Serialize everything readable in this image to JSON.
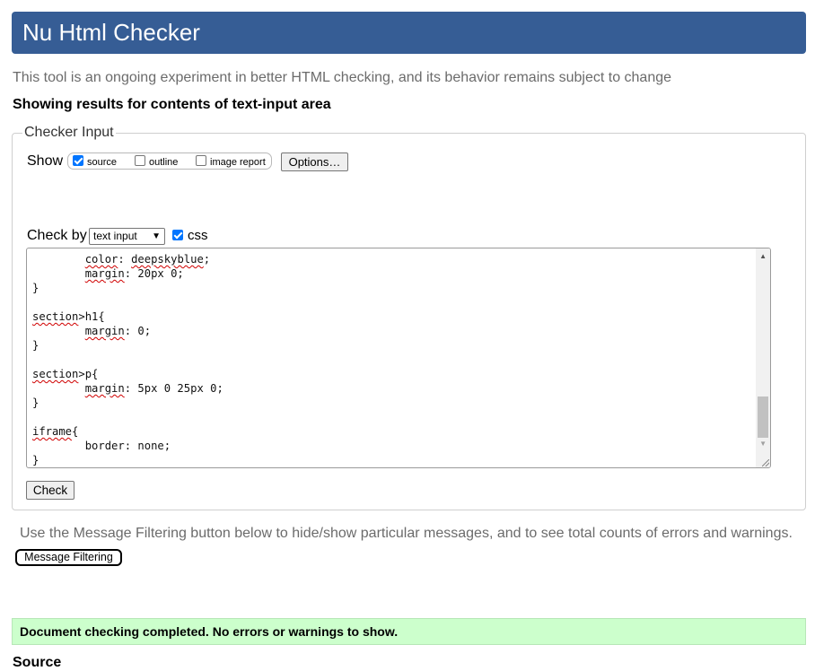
{
  "header": {
    "title": "Nu Html Checker"
  },
  "intro_text": "This tool is an ongoing experiment in better HTML checking, and its behavior remains subject to change",
  "results_heading": "Showing results for contents of text-input area",
  "checker_input": {
    "legend": "Checker Input",
    "show_label": "Show",
    "show_options": [
      {
        "label": "source",
        "checked": true
      },
      {
        "label": "outline",
        "checked": false
      },
      {
        "label": "image report",
        "checked": false
      }
    ],
    "options_button": "Options…",
    "check_by_label": "Check by",
    "check_by_select": "text input",
    "css_label": "css",
    "css_checked": true,
    "check_button": "Check"
  },
  "code_lines": [
    {
      "pre": "        ",
      "sq": "color",
      "post": ": ",
      "sq2": "deepskyblue",
      "post2": ";"
    },
    {
      "pre": "        ",
      "sq": "margin",
      "post": ": 20px 0;"
    },
    {
      "pre": "}"
    },
    {
      "pre": ""
    },
    {
      "pre": "",
      "sq": "section",
      "post": ">h1{"
    },
    {
      "pre": "        ",
      "sq": "margin",
      "post": ": 0;"
    },
    {
      "pre": "}"
    },
    {
      "pre": ""
    },
    {
      "pre": "",
      "sq": "section",
      "post": ">p{"
    },
    {
      "pre": "        ",
      "sq": "margin",
      "post": ": 5px 0 25px 0;"
    },
    {
      "pre": "}"
    },
    {
      "pre": ""
    },
    {
      "pre": "",
      "sq": "iframe",
      "post": "{"
    },
    {
      "pre": "        border: none;"
    },
    {
      "pre": "}"
    }
  ],
  "filter_note": "Use the Message Filtering button below to hide/show particular messages, and to see total counts of errors and warnings.",
  "message_filtering_button": "Message Filtering",
  "status_message": "Document checking completed. No errors or warnings to show.",
  "source_heading": "Source",
  "colors": {
    "header_bg": "#365d95",
    "success_bg": "#ccffcc",
    "checkbox_checked": "#0075ff"
  }
}
